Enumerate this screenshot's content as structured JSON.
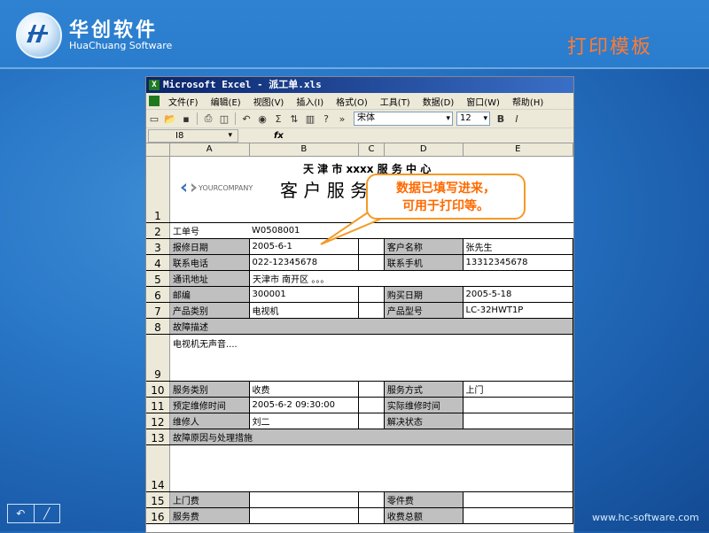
{
  "brand": {
    "name_cn": "华创软件",
    "name_en": "HuaChuang Software"
  },
  "slide_title": "打印模板",
  "excel": {
    "window_title": "Microsoft Excel - 派工单.xls",
    "menus": [
      "文件(F)",
      "编辑(E)",
      "视图(V)",
      "插入(I)",
      "格式(O)",
      "工具(T)",
      "数据(D)",
      "窗口(W)",
      "帮助(H)"
    ],
    "font_name": "宋体",
    "font_size": "12",
    "bold_label": "B",
    "italic_label": "I",
    "cell_ref": "I8",
    "fx_label": "fx",
    "columns": [
      "A",
      "B",
      "C",
      "D",
      "E"
    ],
    "header_title": "天 津 市 xxxx 服 务 中 心",
    "header_subtitle": "客 户 服 务",
    "logo_text": "YOURCOMPANY",
    "rows": {
      "r2": {
        "label": "工单号",
        "value": "W0508001"
      },
      "r3": {
        "l1": "报修日期",
        "v1": "2005-6-1",
        "l2": "客户名称",
        "v2": "张先生"
      },
      "r4": {
        "l1": "联系电话",
        "v1": "022-12345678",
        "l2": "联系手机",
        "v2": "13312345678"
      },
      "r5": {
        "l1": "通讯地址",
        "v1": "天津市 南开区 。。。"
      },
      "r6": {
        "l1": "邮编",
        "v1": "300001",
        "l2": "购买日期",
        "v2": "2005-5-18"
      },
      "r7": {
        "l1": "产品类别",
        "v1": "电视机",
        "l2": "产品型号",
        "v2": "LC-32HWT1P"
      },
      "r8": {
        "l1": "故障描述"
      },
      "r9": {
        "v1": "电视机无声音...."
      },
      "r10": {
        "l1": "服务类别",
        "v1": "收费",
        "l2": "服务方式",
        "v2": "上门"
      },
      "r11": {
        "l1": "预定维修时间",
        "v1": "2005-6-2 09:30:00",
        "l2": "实际维修时间",
        "v2": ""
      },
      "r12": {
        "l1": "维修人",
        "v1": "刘二",
        "l2": "解决状态",
        "v2": ""
      },
      "r13": {
        "l1": "故障原因与处理措施"
      },
      "r15": {
        "l1": "上门费",
        "v1": "",
        "l2": "零件费",
        "v2": ""
      },
      "r16": {
        "l1": "服务费",
        "v1": "",
        "l2": "收费总额",
        "v2": ""
      }
    },
    "row_numbers": [
      "1",
      "2",
      "3",
      "4",
      "5",
      "6",
      "7",
      "8",
      "9",
      "10",
      "11",
      "12",
      "13",
      "14",
      "15",
      "16"
    ]
  },
  "callout": {
    "line1": "数据已填写进来，",
    "line2": "可用于打印等。"
  },
  "footer_url": "www.hc-software.com",
  "colors": {
    "accent_orange": "#ff7a30",
    "callout_border": "#f39a26",
    "shade": "#c0c0c0"
  }
}
